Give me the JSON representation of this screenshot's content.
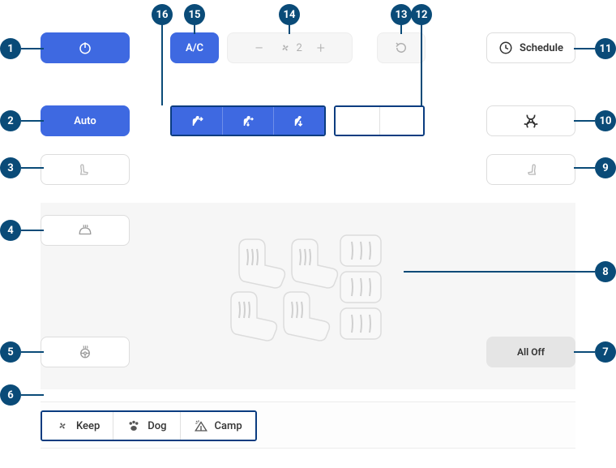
{
  "buttons": {
    "auto": "Auto",
    "ac": "A/C",
    "schedule": "Schedule",
    "all_off": "All Off"
  },
  "fan": {
    "speed": "2"
  },
  "modes": {
    "keep": "Keep",
    "dog": "Dog",
    "camp": "Camp"
  },
  "callouts": {
    "1": "1",
    "2": "2",
    "3": "3",
    "4": "4",
    "5": "5",
    "6": "6",
    "7": "7",
    "8": "8",
    "9": "9",
    "10": "10",
    "11": "11",
    "12": "12",
    "13": "13",
    "14": "14",
    "15": "15",
    "16": "16"
  }
}
